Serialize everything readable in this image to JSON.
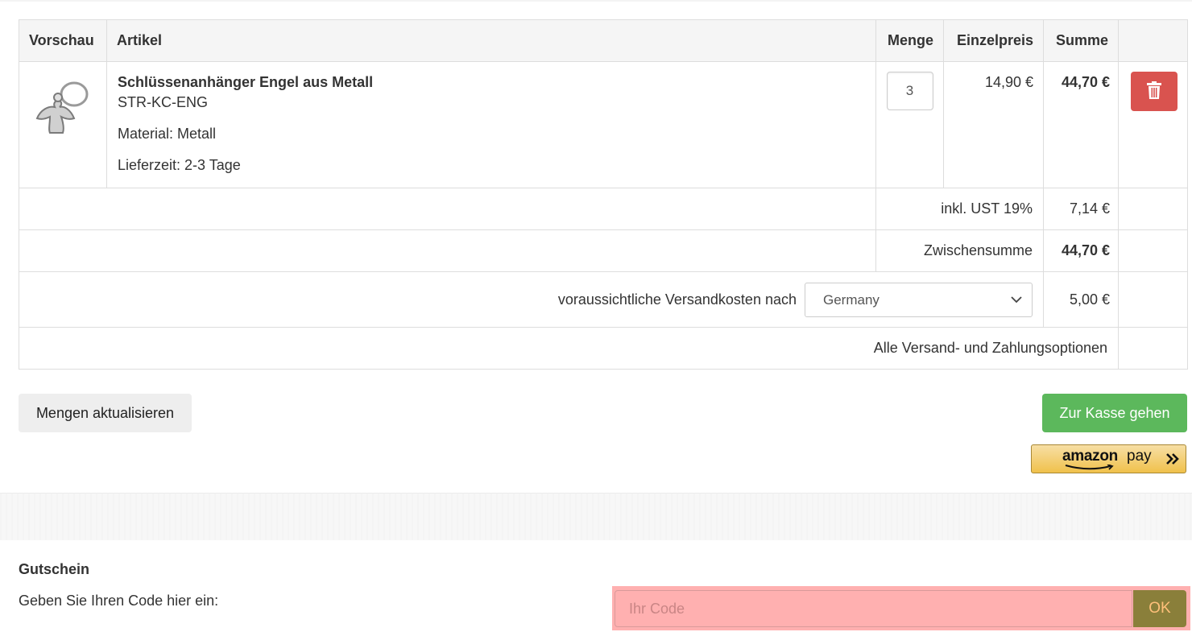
{
  "table": {
    "headers": {
      "preview": "Vorschau",
      "article": "Artikel",
      "quantity": "Menge",
      "unit_price": "Einzelpreis",
      "total": "Summe"
    },
    "item": {
      "name": "Schlüssenanhänger Engel aus Metall",
      "sku": "STR-KC-ENG",
      "material": "Material: Metall",
      "delivery": "Lieferzeit: 2-3 Tage",
      "quantity": "3",
      "unit_price": "14,90 €",
      "total": "44,70 €",
      "thumbnail_icon": "angel-keychain-icon",
      "delete_icon": "trash-icon"
    },
    "tax": {
      "label": "inkl. UST 19%",
      "value": "7,14 €"
    },
    "subtotal": {
      "label": "Zwischensumme",
      "value": "44,70 €"
    },
    "shipping": {
      "label": "voraussichtliche Versandkosten nach",
      "country": "Germany",
      "value": "5,00 €"
    },
    "options_link": "Alle Versand- und Zahlungsoptionen"
  },
  "actions": {
    "update_label": "Mengen aktualisieren",
    "checkout_label": "Zur Kasse gehen",
    "amazon_logo": "amazon",
    "amazon_pay": "pay"
  },
  "coupon": {
    "title": "Gutschein",
    "description": "Geben Sie Ihren Code hier ein:",
    "placeholder": "Ihr Code",
    "ok_label": "OK"
  },
  "colors": {
    "delete": "#d9534f",
    "checkout": "#5cb85c",
    "coupon_highlight": "#ffb0b0",
    "ok_button": "#8a7f3a"
  }
}
